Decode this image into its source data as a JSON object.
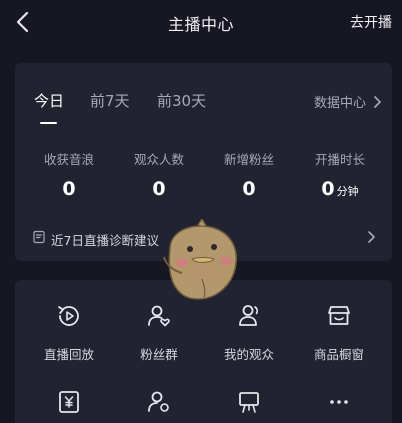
{
  "header": {
    "title": "主播中心",
    "right_action": "去开播"
  },
  "tabs": [
    {
      "label": "今日",
      "active": true
    },
    {
      "label": "前7天",
      "active": false
    },
    {
      "label": "前30天",
      "active": false
    }
  ],
  "data_center_link": "数据中心",
  "stats": [
    {
      "label": "收获音浪",
      "value": "0",
      "unit": ""
    },
    {
      "label": "观众人数",
      "value": "0",
      "unit": ""
    },
    {
      "label": "新增粉丝",
      "value": "0",
      "unit": ""
    },
    {
      "label": "开播时长",
      "value": "0",
      "unit": "分钟"
    }
  ],
  "diagnosis": {
    "label": "近7日直播诊断建议"
  },
  "functions": [
    {
      "label": "直播回放",
      "icon": "replay-icon"
    },
    {
      "label": "粉丝群",
      "icon": "fan-group-icon"
    },
    {
      "label": "我的观众",
      "icon": "audience-icon"
    },
    {
      "label": "商品橱窗",
      "icon": "shop-window-icon"
    },
    {
      "label": "",
      "icon": "income-icon"
    },
    {
      "label": "",
      "icon": "user-settings-icon"
    },
    {
      "label": "",
      "icon": "easel-icon"
    },
    {
      "label": "",
      "icon": "more-icon"
    }
  ],
  "colors": {
    "background": "#161722",
    "card": "#222331",
    "text_primary": "#ffffff",
    "text_secondary": "#a8a9b4"
  }
}
